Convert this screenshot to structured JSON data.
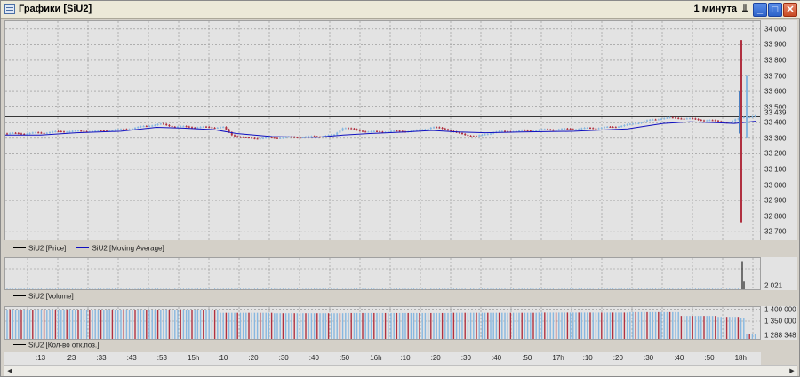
{
  "window": {
    "title": "Графики [SiU2]",
    "interval": "1 минута",
    "pin_glyph": "⫫",
    "minimize_glyph": "_",
    "maximize_glyph": "□",
    "close_glyph": "✕"
  },
  "legends": {
    "price": {
      "items": [
        {
          "label": "SiU2 [Price]",
          "color": "#000000"
        },
        {
          "label": "SiU2 [Moving Average]",
          "color": "#1010c0"
        }
      ]
    },
    "volume": {
      "items": [
        {
          "label": "SiU2 [Volume]",
          "color": "#000000"
        }
      ]
    },
    "oi": {
      "items": [
        {
          "label": "SiU2 [Кол-во отк.поз.]",
          "color": "#000000"
        }
      ]
    }
  },
  "colors": {
    "up": "#87b7e0",
    "down": "#b03040",
    "ma": "#1010c0",
    "grid": "#8f8f8f",
    "pane_bg": "#e3e3e3"
  },
  "time_axis": {
    "labels": [
      ":13",
      ":23",
      ":33",
      ":43",
      ":53",
      "15h",
      ":10",
      ":20",
      ":30",
      ":40",
      ":50",
      "16h",
      ":10",
      ":20",
      ":30",
      ":40",
      ":50",
      "17h",
      ":10",
      ":20",
      ":30",
      ":40",
      ":50",
      "18h"
    ]
  },
  "chart_data": [
    {
      "type": "line",
      "name": "price",
      "title": "",
      "series": [
        {
          "name": "SiU2 [Price]"
        },
        {
          "name": "SiU2 [Moving Average]"
        }
      ],
      "ylim": [
        32650,
        34050
      ],
      "y_ticks": [
        34000,
        33900,
        33800,
        33700,
        33600,
        33500,
        33400,
        33300,
        33200,
        33100,
        33000,
        32900,
        32800,
        32700
      ],
      "y_tick_labels": [
        "34 000",
        "33 900",
        "33 800",
        "33 700",
        "33 600",
        "33 500",
        "33 400",
        "33 300",
        "33 200",
        "33 100",
        "33 000",
        "32 900",
        "32 800",
        "32 700"
      ],
      "hline": 33439,
      "hline_label": "33 439",
      "close_points": [
        [
          0,
          33330
        ],
        [
          20,
          33330
        ],
        [
          40,
          33335
        ],
        [
          70,
          33345
        ],
        [
          100,
          33345
        ],
        [
          130,
          33355
        ],
        [
          150,
          33370
        ],
        [
          165,
          33385
        ],
        [
          175,
          33390
        ],
        [
          190,
          33375
        ],
        [
          220,
          33370
        ],
        [
          245,
          33370
        ],
        [
          255,
          33320
        ],
        [
          270,
          33300
        ],
        [
          290,
          33300
        ],
        [
          320,
          33305
        ],
        [
          350,
          33310
        ],
        [
          370,
          33320
        ],
        [
          380,
          33370
        ],
        [
          392,
          33355
        ],
        [
          410,
          33340
        ],
        [
          440,
          33345
        ],
        [
          460,
          33345
        ],
        [
          480,
          33370
        ],
        [
          495,
          33360
        ],
        [
          510,
          33330
        ],
        [
          530,
          33310
        ],
        [
          550,
          33340
        ],
        [
          570,
          33345
        ],
        [
          590,
          33350
        ],
        [
          610,
          33355
        ],
        [
          640,
          33360
        ],
        [
          660,
          33365
        ],
        [
          680,
          33370
        ],
        [
          700,
          33385
        ],
        [
          720,
          33410
        ],
        [
          740,
          33430
        ],
        [
          760,
          33430
        ],
        [
          780,
          33420
        ],
        [
          800,
          33410
        ],
        [
          815,
          33400
        ],
        [
          822,
          33420
        ],
        [
          826,
          33430
        ],
        [
          830,
          33440
        ],
        [
          838,
          33435
        ],
        [
          845,
          33440
        ]
      ],
      "ma_points": [
        [
          0,
          33320
        ],
        [
          40,
          33320
        ],
        [
          80,
          33335
        ],
        [
          130,
          33345
        ],
        [
          170,
          33370
        ],
        [
          200,
          33365
        ],
        [
          235,
          33355
        ],
        [
          260,
          33330
        ],
        [
          300,
          33310
        ],
        [
          350,
          33305
        ],
        [
          380,
          33320
        ],
        [
          410,
          33330
        ],
        [
          450,
          33340
        ],
        [
          480,
          33350
        ],
        [
          510,
          33340
        ],
        [
          540,
          33335
        ],
        [
          580,
          33340
        ],
        [
          640,
          33345
        ],
        [
          700,
          33360
        ],
        [
          740,
          33395
        ],
        [
          770,
          33405
        ],
        [
          800,
          33400
        ],
        [
          820,
          33395
        ],
        [
          845,
          33410
        ]
      ],
      "spikes": [
        {
          "x": 828,
          "high": 33930,
          "low": 32760,
          "color": "#b03040"
        },
        {
          "x": 826,
          "high": 33600,
          "low": 33330,
          "color": "#4a7fc0"
        },
        {
          "x": 834,
          "high": 33700,
          "low": 33300,
          "color": "#87b7e0"
        }
      ]
    },
    {
      "type": "bar",
      "name": "volume",
      "title": "",
      "series": [
        {
          "name": "SiU2 [Volume]"
        }
      ],
      "ylim": [
        0,
        1000
      ],
      "y_tick_label": "2 021",
      "baseline_value": 25,
      "spikes": [
        {
          "x": 829,
          "value": 900
        },
        {
          "x": 831,
          "value": 250
        }
      ]
    },
    {
      "type": "bar",
      "name": "open_interest",
      "title": "",
      "series": [
        {
          "name": "SiU2 [Кол-во отк.поз.]"
        }
      ],
      "ylim": [
        1275000,
        1410000
      ],
      "y_ticks": [
        1400000,
        1350000,
        1288348
      ],
      "y_tick_labels": [
        "1 400 000",
        "1 350 000",
        "1 288 348"
      ],
      "segments": [
        [
          0,
          1395000
        ],
        [
          230,
          1395000
        ],
        [
          240,
          1385000
        ],
        [
          300,
          1383000
        ],
        [
          380,
          1384000
        ],
        [
          500,
          1385000
        ],
        [
          600,
          1386000
        ],
        [
          700,
          1388000
        ],
        [
          755,
          1388000
        ],
        [
          760,
          1372000
        ],
        [
          800,
          1368000
        ],
        [
          825,
          1365000
        ],
        [
          832,
          1295000
        ],
        [
          845,
          1290000
        ]
      ]
    }
  ]
}
